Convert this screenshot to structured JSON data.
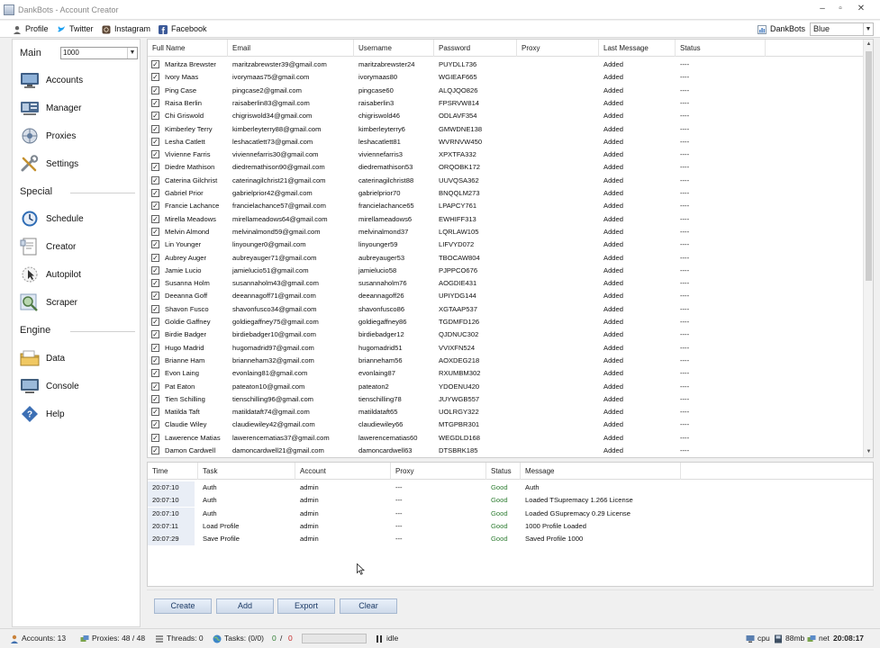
{
  "window": {
    "title": "DankBots - Account Creator",
    "minimize": "–",
    "restore": "▫",
    "close": "✕"
  },
  "menubar": {
    "items": [
      {
        "label": "Profile",
        "icon": "profile-icon"
      },
      {
        "label": "Twitter",
        "icon": "twitter-icon"
      },
      {
        "label": "Instagram",
        "icon": "instagram-icon"
      },
      {
        "label": "Facebook",
        "icon": "facebook-icon"
      }
    ],
    "brand": "DankBots",
    "theme": "Blue"
  },
  "sidebar": {
    "main_heading": "Main",
    "profile_value": "1000",
    "main_items": [
      "Accounts",
      "Manager",
      "Proxies",
      "Settings"
    ],
    "special_heading": "Special",
    "special_items": [
      "Schedule",
      "Creator",
      "Autopilot",
      "Scraper"
    ],
    "engine_heading": "Engine",
    "engine_items": [
      "Data",
      "Console",
      "Help"
    ]
  },
  "accounts_table": {
    "columns": [
      "Full Name",
      "Email",
      "Username",
      "Password",
      "Proxy",
      "Last Message",
      "Status"
    ],
    "rows": [
      [
        "Maritza Brewster",
        "maritzabrewster39@gmail.com",
        "maritzabrewster24",
        "PUYDLL736",
        "",
        "Added",
        "----"
      ],
      [
        "Ivory Maas",
        "ivorymaas75@gmail.com",
        "ivorymaas80",
        "WGIEAF665",
        "",
        "Added",
        "----"
      ],
      [
        "Ping Case",
        "pingcase2@gmail.com",
        "pingcase60",
        "ALQJQO826",
        "",
        "Added",
        "----"
      ],
      [
        "Raisa Berlin",
        "raisaberlin83@gmail.com",
        "raisaberlin3",
        "FPSRVW814",
        "",
        "Added",
        "----"
      ],
      [
        "Chi Griswold",
        "chigriswold34@gmail.com",
        "chigriswold46",
        "ODLAVF354",
        "",
        "Added",
        "----"
      ],
      [
        "Kimberley Terry",
        "kimberleyterry88@gmail.com",
        "kimberleyterry6",
        "GMWDNE138",
        "",
        "Added",
        "----"
      ],
      [
        "Lesha Catlett",
        "leshacatlett73@gmail.com",
        "leshacatlett81",
        "WVRNVW450",
        "",
        "Added",
        "----"
      ],
      [
        "Vivienne Farris",
        "viviennefarris30@gmail.com",
        "viviennefarris3",
        "XPXTFA332",
        "",
        "Added",
        "----"
      ],
      [
        "Diedre Mathison",
        "diedremathison90@gmail.com",
        "diedremathison53",
        "ORQOBK172",
        "",
        "Added",
        "----"
      ],
      [
        "Caterina Gilchrist",
        "caterinagilchrist21@gmail.com",
        "caterinagilchrist88",
        "UUVQSA362",
        "",
        "Added",
        "----"
      ],
      [
        "Gabriel Prior",
        "gabrielprior42@gmail.com",
        "gabrielprior70",
        "BNQQLM273",
        "",
        "Added",
        "----"
      ],
      [
        "Francie Lachance",
        "francielachance57@gmail.com",
        "francielachance65",
        "LPAPCY761",
        "",
        "Added",
        "----"
      ],
      [
        "Mirella Meadows",
        "mirellameadows64@gmail.com",
        "mirellameadows6",
        "EWHIFF313",
        "",
        "Added",
        "----"
      ],
      [
        "Melvin Almond",
        "melvinalmond59@gmail.com",
        "melvinalmond37",
        "LQRLAW105",
        "",
        "Added",
        "----"
      ],
      [
        "Lin Younger",
        "linyounger0@gmail.com",
        "linyounger59",
        "LIFVYD072",
        "",
        "Added",
        "----"
      ],
      [
        "Aubrey Auger",
        "aubreyauger71@gmail.com",
        "aubreyauger53",
        "TBOCAW804",
        "",
        "Added",
        "----"
      ],
      [
        "Jamie Lucio",
        "jamielucio51@gmail.com",
        "jamielucio58",
        "PJPPCO676",
        "",
        "Added",
        "----"
      ],
      [
        "Susanna Holm",
        "susannaholm43@gmail.com",
        "susannaholm76",
        "AOGDIE431",
        "",
        "Added",
        "----"
      ],
      [
        "Deeanna Goff",
        "deeannagoff71@gmail.com",
        "deeannagoff26",
        "UPIYDG144",
        "",
        "Added",
        "----"
      ],
      [
        "Shavon Fusco",
        "shavonfusco34@gmail.com",
        "shavonfusco86",
        "XGTAAP537",
        "",
        "Added",
        "----"
      ],
      [
        "Goldie Gaffney",
        "goldiegaffney75@gmail.com",
        "goldiegaffney86",
        "TGDMFD126",
        "",
        "Added",
        "----"
      ],
      [
        "Birdie Badger",
        "birdiebadger10@gmail.com",
        "birdiebadger12",
        "QJDNUC302",
        "",
        "Added",
        "----"
      ],
      [
        "Hugo Madrid",
        "hugomadrid97@gmail.com",
        "hugomadrid51",
        "VVIXFN524",
        "",
        "Added",
        "----"
      ],
      [
        "Brianne Ham",
        "brianneham32@gmail.com",
        "brianneham56",
        "AOXDEG218",
        "",
        "Added",
        "----"
      ],
      [
        "Evon Laing",
        "evonlaing81@gmail.com",
        "evonlaing87",
        "RXUMBM302",
        "",
        "Added",
        "----"
      ],
      [
        "Pat Eaton",
        "pateaton10@gmail.com",
        "pateaton2",
        "YDOENU420",
        "",
        "Added",
        "----"
      ],
      [
        "Tien Schilling",
        "tienschilling96@gmail.com",
        "tienschilling78",
        "JUYWGB557",
        "",
        "Added",
        "----"
      ],
      [
        "Matilda Taft",
        "matildataft74@gmail.com",
        "matildataft65",
        "UOLRGY322",
        "",
        "Added",
        "----"
      ],
      [
        "Claudie Wiley",
        "claudiewiley42@gmail.com",
        "claudiewiley66",
        "MTGPBR301",
        "",
        "Added",
        "----"
      ],
      [
        "Lawerence Matias",
        "lawerencematias37@gmail.com",
        "lawerencematias60",
        "WEGDLD168",
        "",
        "Added",
        "----"
      ],
      [
        "Damon Cardwell",
        "damoncardwell21@gmail.com",
        "damoncardwell63",
        "DTSBRK185",
        "",
        "Added",
        "----"
      ]
    ]
  },
  "log_table": {
    "columns": [
      "Time",
      "Task",
      "Account",
      "Proxy",
      "Status",
      "Message"
    ],
    "rows": [
      [
        "20:07:10",
        "Auth",
        "admin",
        "---",
        "Good",
        "Auth"
      ],
      [
        "20:07:10",
        "Auth",
        "admin",
        "---",
        "Good",
        "Loaded TSupremacy 1.266 License"
      ],
      [
        "20:07:10",
        "Auth",
        "admin",
        "---",
        "Good",
        "Loaded GSupremacy 0.29 License"
      ],
      [
        "20:07:11",
        "Load Profile",
        "admin",
        "---",
        "Good",
        "1000 Profile Loaded"
      ],
      [
        "20:07:29",
        "Save Profile",
        "admin",
        "---",
        "Good",
        "Saved Profile 1000"
      ]
    ]
  },
  "actions": {
    "create": "Create",
    "add": "Add",
    "export": "Export",
    "clear": "Clear"
  },
  "statusbar": {
    "accounts": "Accounts: 13",
    "proxies": "Proxies: 48 / 48",
    "threads": "Threads: 0",
    "tasks": "Tasks: (0/0)",
    "ok_count": "0",
    "sep": "/",
    "fail_count": "0",
    "progress": 0,
    "state": "idle",
    "cpu": "cpu",
    "memory": "88mb",
    "net": "net",
    "clock": "20:08:17"
  },
  "colors": {
    "accent": "#2f6db5",
    "good": "#2e7d32",
    "fail": "#c62828",
    "time_cell": "#e9eef6"
  }
}
